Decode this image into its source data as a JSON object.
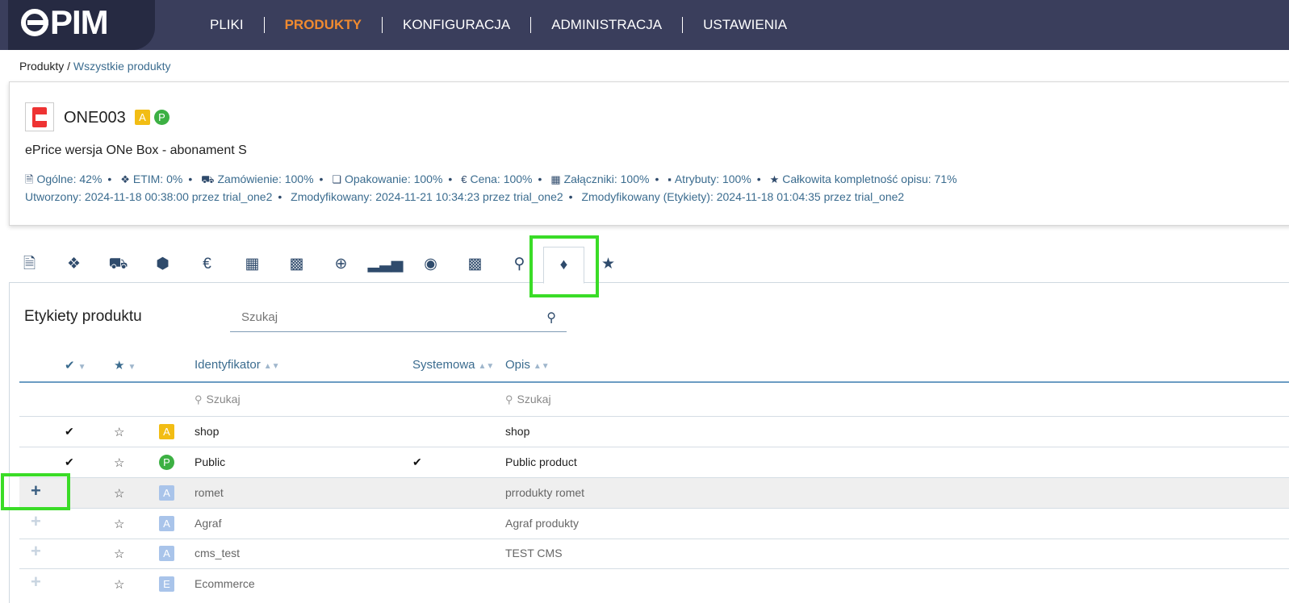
{
  "app": {
    "logo_text": "PIM"
  },
  "nav": {
    "items": [
      {
        "label": "PLIKI"
      },
      {
        "label": "PRODUKTY"
      },
      {
        "label": "KONFIGURACJA"
      },
      {
        "label": "ADMINISTRACJA"
      },
      {
        "label": "USTAWIENIA"
      }
    ],
    "active_color": "#f08a30"
  },
  "breadcrumb": {
    "root": "Produkty",
    "separator": " / ",
    "current": "Wszystkie produkty"
  },
  "product": {
    "code": "ONE003",
    "badge_a": "A",
    "badge_p": "P",
    "description": "ePrice wersja ONe Box - abonament S",
    "stats": {
      "ogolne": "Ogólne: 42%",
      "etim": "ETIM: 0%",
      "zamowienie": "Zamówienie: 100%",
      "opakowanie": "Opakowanie: 100%",
      "cena": "Cena: 100%",
      "zalaczniki": "Załączniki: 100%",
      "atrybuty": "Atrybuty: 100%",
      "calkowita": "Całkowita kompletność opisu: 71%"
    },
    "meta": {
      "utworzony": "Utworzony: 2024-11-18 00:38:00 przez trial_one2",
      "zmodyfikowany": "Zmodyfikowany: 2024-11-21 10:34:23 przez trial_one2",
      "zmodyfikowany_etykiety": "Zmodyfikowany (Etykiety): 2024-11-18 01:04:35 przez trial_one2"
    }
  },
  "tabs": {
    "icons": [
      "document-icon",
      "etim-icon",
      "truck-icon",
      "box-icon",
      "euro-icon",
      "image-icon",
      "note-icon",
      "plus-circle-icon",
      "signal-icon",
      "globe-icon",
      "puzzle-icon",
      "sitemap-icon",
      "tag-icon",
      "star-icon"
    ],
    "active": "tag-icon"
  },
  "labels_panel": {
    "title": "Etykiety produktu",
    "search_placeholder": "Szukaj",
    "columns": {
      "identyfikator": "Identyfikator",
      "systemowa": "Systemowa",
      "opis": "Opis"
    },
    "filter_placeholder_id": "Szukaj",
    "filter_placeholder_opis": "Szukaj",
    "rows": [
      {
        "assigned": true,
        "badge": "A",
        "id": "shop",
        "system": false,
        "desc": "shop"
      },
      {
        "assigned": true,
        "badge": "P",
        "id": "Public",
        "system": true,
        "desc": "Public product"
      },
      {
        "assigned": false,
        "badge": "A",
        "id": "romet",
        "system": false,
        "desc": "prrodukty romet"
      },
      {
        "assigned": false,
        "badge": "A",
        "id": "Agraf",
        "system": false,
        "desc": "Agraf produkty"
      },
      {
        "assigned": false,
        "badge": "A",
        "id": "cms_test",
        "system": false,
        "desc": "TEST CMS"
      },
      {
        "assigned": false,
        "badge": "E",
        "id": "Ecommerce",
        "system": false,
        "desc": ""
      }
    ]
  },
  "highlight_color": "#3adc27"
}
